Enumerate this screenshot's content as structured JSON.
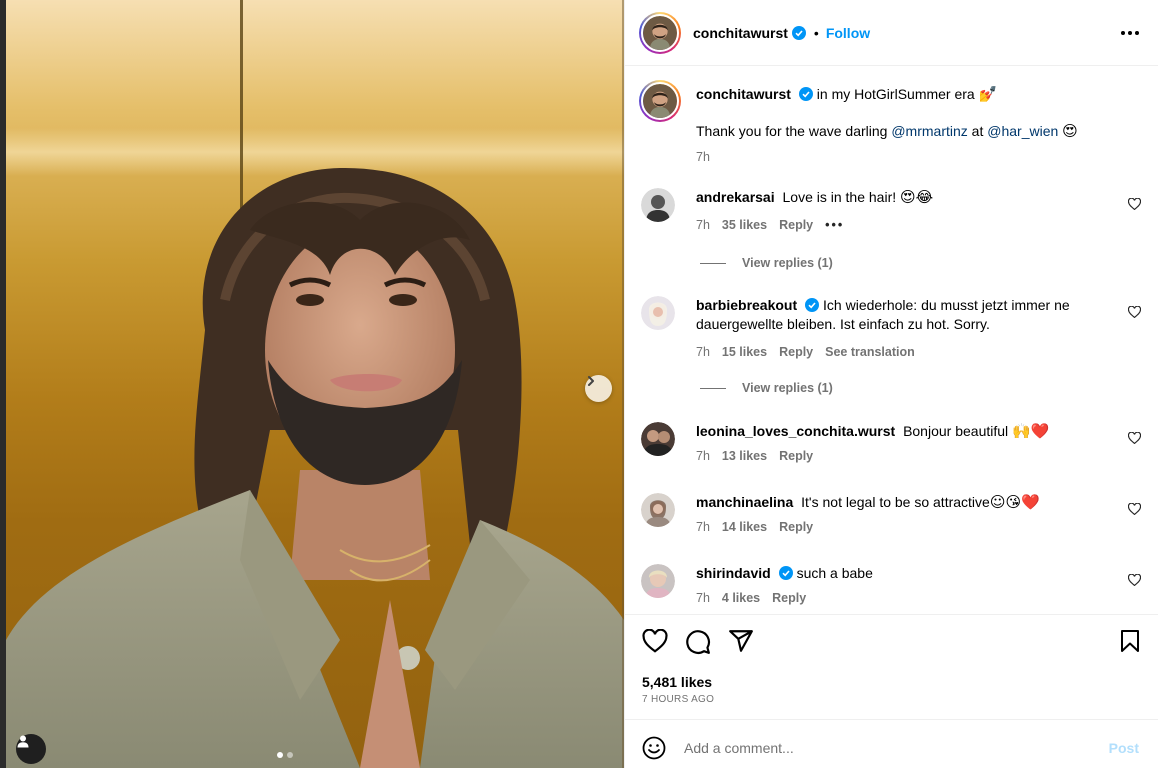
{
  "post": {
    "username": "conchitawurst",
    "verified": true,
    "follow_label": "Follow",
    "separator": "•",
    "caption_text": "in my HotGirlSummer era",
    "caption_emoji": "💅",
    "caption_line2_prefix": "Thank you for the wave darling",
    "caption_mention1": "@mrmartinz",
    "caption_at": "at",
    "caption_mention2": "@har_wien",
    "caption_line2_emoji": "😍",
    "caption_time": "7h"
  },
  "comments": [
    {
      "username": "andrekarsai",
      "verified": false,
      "text": "Love is in the hair!",
      "emoji": "😍😂",
      "time": "7h",
      "likes": "35 likes",
      "reply": "Reply",
      "extra": "•••",
      "view_replies": "View replies (1)"
    },
    {
      "username": "barbiebreakout",
      "verified": true,
      "text": "Ich wiederhole: du musst jetzt immer ne dauergewellte bleiben. Ist einfach zu hot. Sorry.",
      "time": "7h",
      "likes": "15 likes",
      "reply": "Reply",
      "extra": "See translation",
      "view_replies": "View replies (1)"
    },
    {
      "username": "leonina_loves_conchita.wurst",
      "verified": false,
      "text": "Bonjour beautiful",
      "emoji": "🙌❤️",
      "time": "7h",
      "likes": "13 likes",
      "reply": "Reply"
    },
    {
      "username": "manchinaelina",
      "verified": false,
      "text": "It's not legal to be so attractive",
      "emoji": "☺😘❤️",
      "time": "7h",
      "likes": "14 likes",
      "reply": "Reply"
    },
    {
      "username": "shirindavid",
      "verified": true,
      "text": "such a babe",
      "time": "7h",
      "likes": "4 likes",
      "reply": "Reply"
    }
  ],
  "stats": {
    "likes": "5,481 likes",
    "ago": "7 HOURS AGO"
  },
  "add_comment": {
    "placeholder": "Add a comment...",
    "post_label": "Post"
  },
  "colors": {
    "accent": "#0095f6",
    "mention": "#00376b",
    "muted": "#737373",
    "post_disabled": "#b2dffc"
  },
  "icons": [
    "heart-icon",
    "comment-icon",
    "share-icon",
    "bookmark-icon",
    "emoji-icon",
    "chevron-right-icon",
    "user-tag-icon",
    "more-icon",
    "verified-icon"
  ],
  "carousel": {
    "total": 2,
    "active": 1
  }
}
